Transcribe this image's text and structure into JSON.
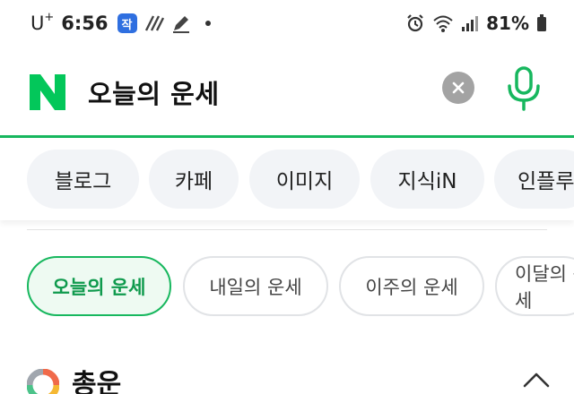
{
  "status_bar": {
    "carrier": "U",
    "carrier_sup": "+",
    "time": "6:56",
    "app_badge": "작",
    "battery": "81%"
  },
  "search": {
    "query": "오늘의 운세"
  },
  "tabs": [
    {
      "label": "블로그"
    },
    {
      "label": "카페"
    },
    {
      "label": "이미지"
    },
    {
      "label": "지식iN"
    },
    {
      "label": "인플루"
    }
  ],
  "fortune_tabs": [
    {
      "label": "오늘의 운세",
      "active": true
    },
    {
      "label": "내일의 운세",
      "active": false
    },
    {
      "label": "이주의 운세",
      "active": false
    },
    {
      "label": "이달의 운세",
      "active": false
    }
  ],
  "section": {
    "title": "총운"
  },
  "colors": {
    "brand_green": "#17b75e",
    "chip_bg": "#f2f4f7",
    "clear_gray": "#a3a3a3"
  }
}
